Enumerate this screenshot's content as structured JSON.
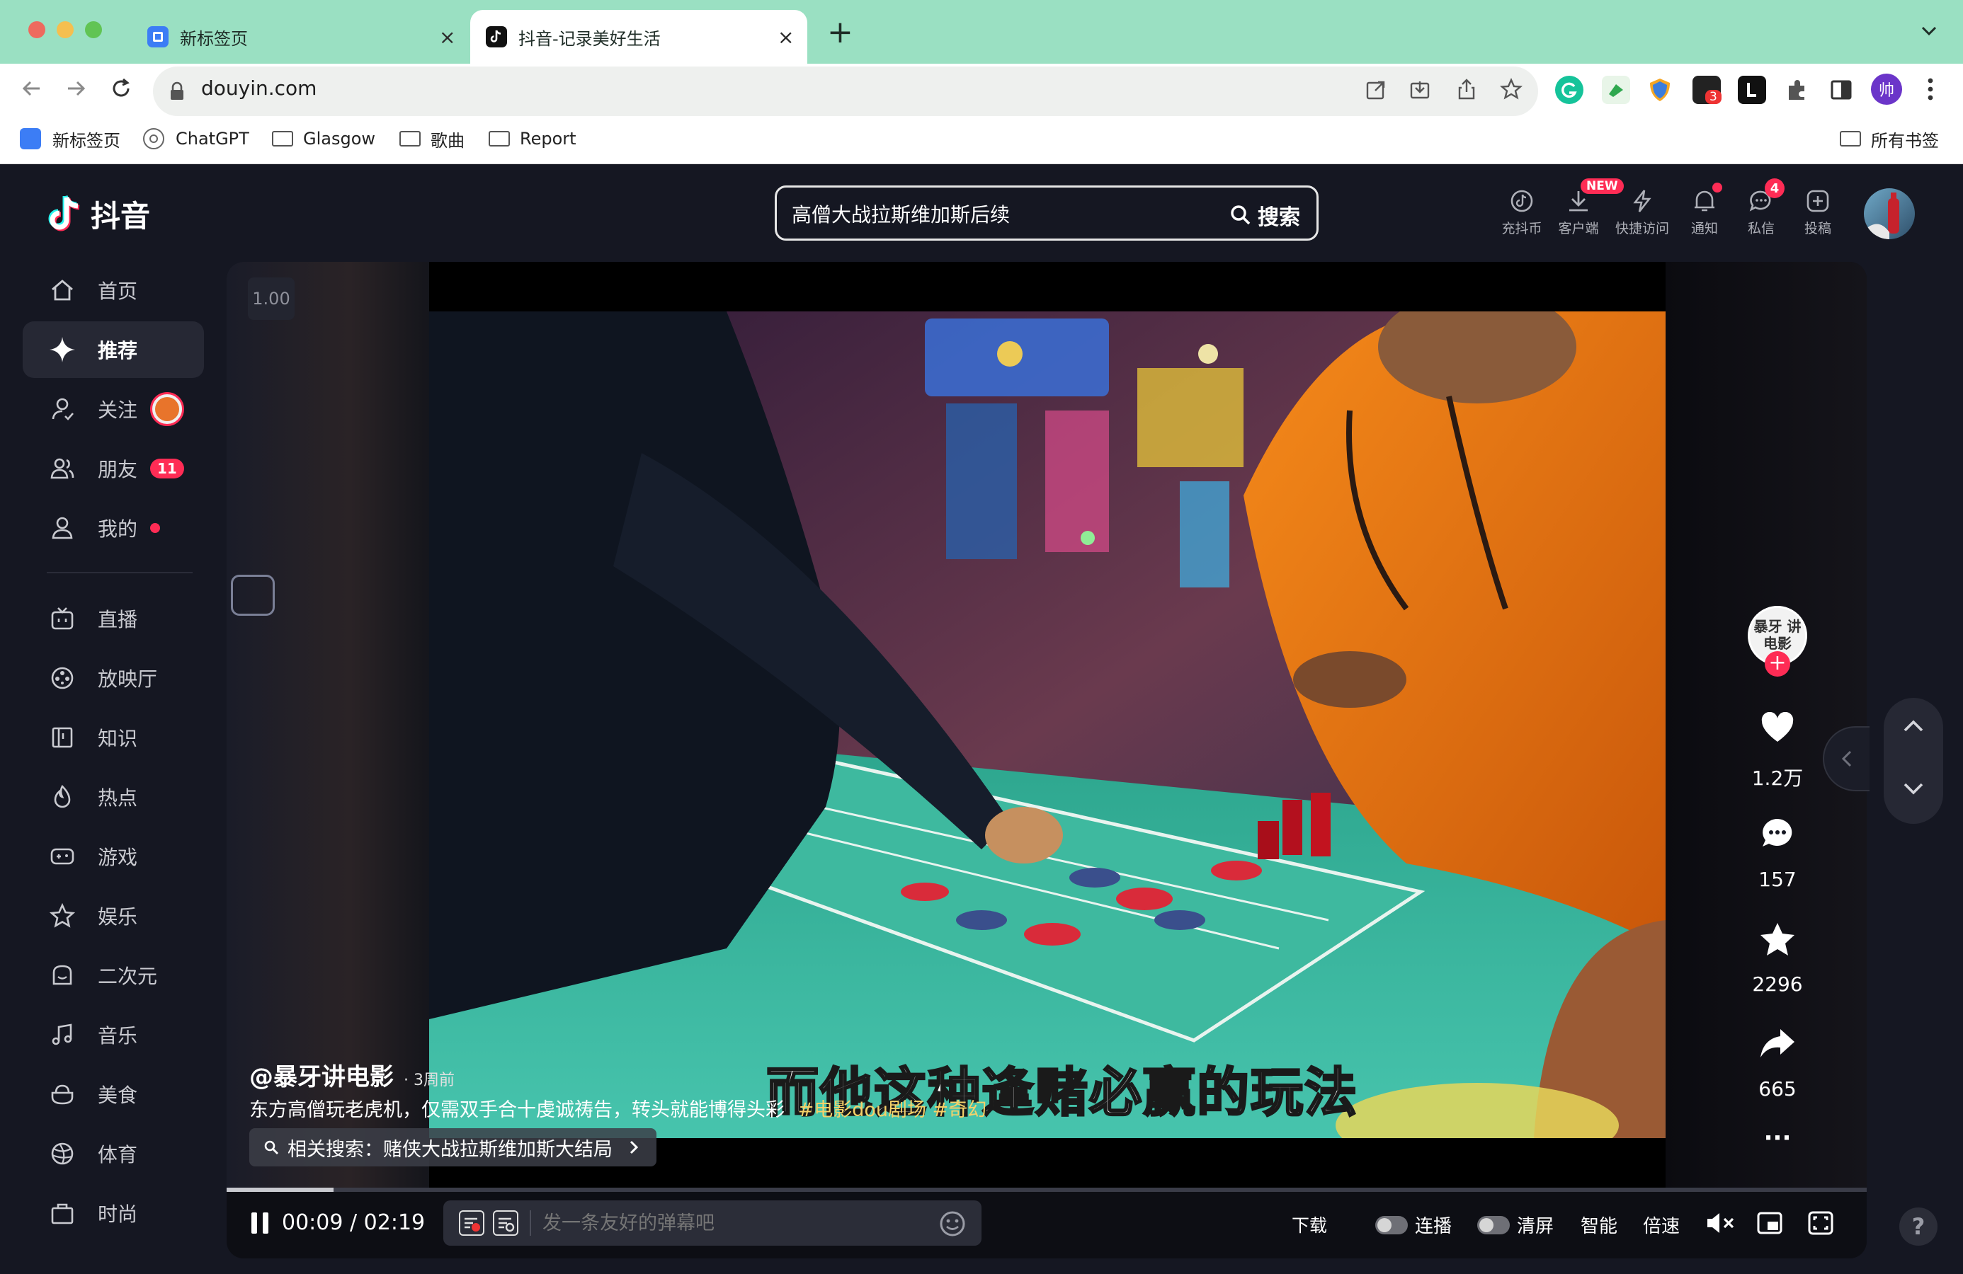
{
  "browser": {
    "tabs": [
      {
        "title": "新标签页",
        "active": false
      },
      {
        "title": "抖音-记录美好生活",
        "active": true
      }
    ],
    "new_tab": "+",
    "tab_close": "×",
    "url": "douyin.com",
    "extension_badge": "3",
    "profile_initial": "帅",
    "bookmarks": [
      {
        "label": "新标签页",
        "icon": "new-tab-icon"
      },
      {
        "label": "ChatGPT",
        "icon": "chatgpt-icon"
      },
      {
        "label": "Glasgow",
        "icon": "folder-icon"
      },
      {
        "label": "歌曲",
        "icon": "folder-icon"
      },
      {
        "label": "Report",
        "icon": "folder-icon"
      }
    ],
    "all_bookmarks": "所有书签"
  },
  "douyin": {
    "logo_text": "抖音",
    "nav": [
      {
        "label": "首页",
        "icon": "home-icon"
      },
      {
        "label": "推荐",
        "icon": "sparkle-icon",
        "active": true
      },
      {
        "label": "关注",
        "icon": "follow-icon"
      },
      {
        "label": "朋友",
        "icon": "friends-icon",
        "badge": "11"
      },
      {
        "label": "我的",
        "icon": "profile-icon",
        "dot": true
      },
      {
        "label": "直播",
        "icon": "tv-icon"
      },
      {
        "label": "放映厅",
        "icon": "film-icon"
      },
      {
        "label": "知识",
        "icon": "book-icon"
      },
      {
        "label": "热点",
        "icon": "flame-icon"
      },
      {
        "label": "游戏",
        "icon": "gamepad-icon"
      },
      {
        "label": "娱乐",
        "icon": "star-outline-icon"
      },
      {
        "label": "二次元",
        "icon": "anime-icon"
      },
      {
        "label": "音乐",
        "icon": "music-icon"
      },
      {
        "label": "美食",
        "icon": "food-icon"
      },
      {
        "label": "体育",
        "icon": "ball-icon"
      },
      {
        "label": "时尚",
        "icon": "bag-icon"
      }
    ],
    "search": {
      "value": "高僧大战拉斯维加斯后续",
      "button": "搜索"
    },
    "header_actions": [
      {
        "label": "充抖币",
        "icon": "coin-icon"
      },
      {
        "label": "客户端",
        "icon": "download-icon",
        "tag": "NEW"
      },
      {
        "label": "快捷访问",
        "icon": "lightning-icon"
      },
      {
        "label": "通知",
        "icon": "bell-icon",
        "dot": true
      },
      {
        "label": "私信",
        "icon": "message-icon",
        "badge": "4"
      },
      {
        "label": "投稿",
        "icon": "upload-icon"
      }
    ],
    "video": {
      "speed_tag": "1.00",
      "author": "@暴牙讲电影",
      "time_ago": "· 3周前",
      "description": "东方高僧玩老虎机，仅需双手合十虔诚祷告，转头就能博得头彩",
      "hashtags": "#电影dou剧场 #奇幻",
      "subtitle": "而他这种逢赌必赢的玩法",
      "related_search": "相关搜索：赌侠大战拉斯维加斯大结局",
      "author_avatar_text": "暴牙 讲电影",
      "likes": "1.2万",
      "comments": "157",
      "favorites": "2296",
      "shares": "665",
      "more": "···",
      "progress": 0.065
    },
    "controls": {
      "current": "00:09",
      "separator": "/",
      "duration": "02:19",
      "danmaku_placeholder": "发一条友好的弹幕吧",
      "download": "下载",
      "autoplay": "连播",
      "clear": "清屏",
      "smart": "智能",
      "speed": "倍速"
    },
    "help": "?"
  }
}
